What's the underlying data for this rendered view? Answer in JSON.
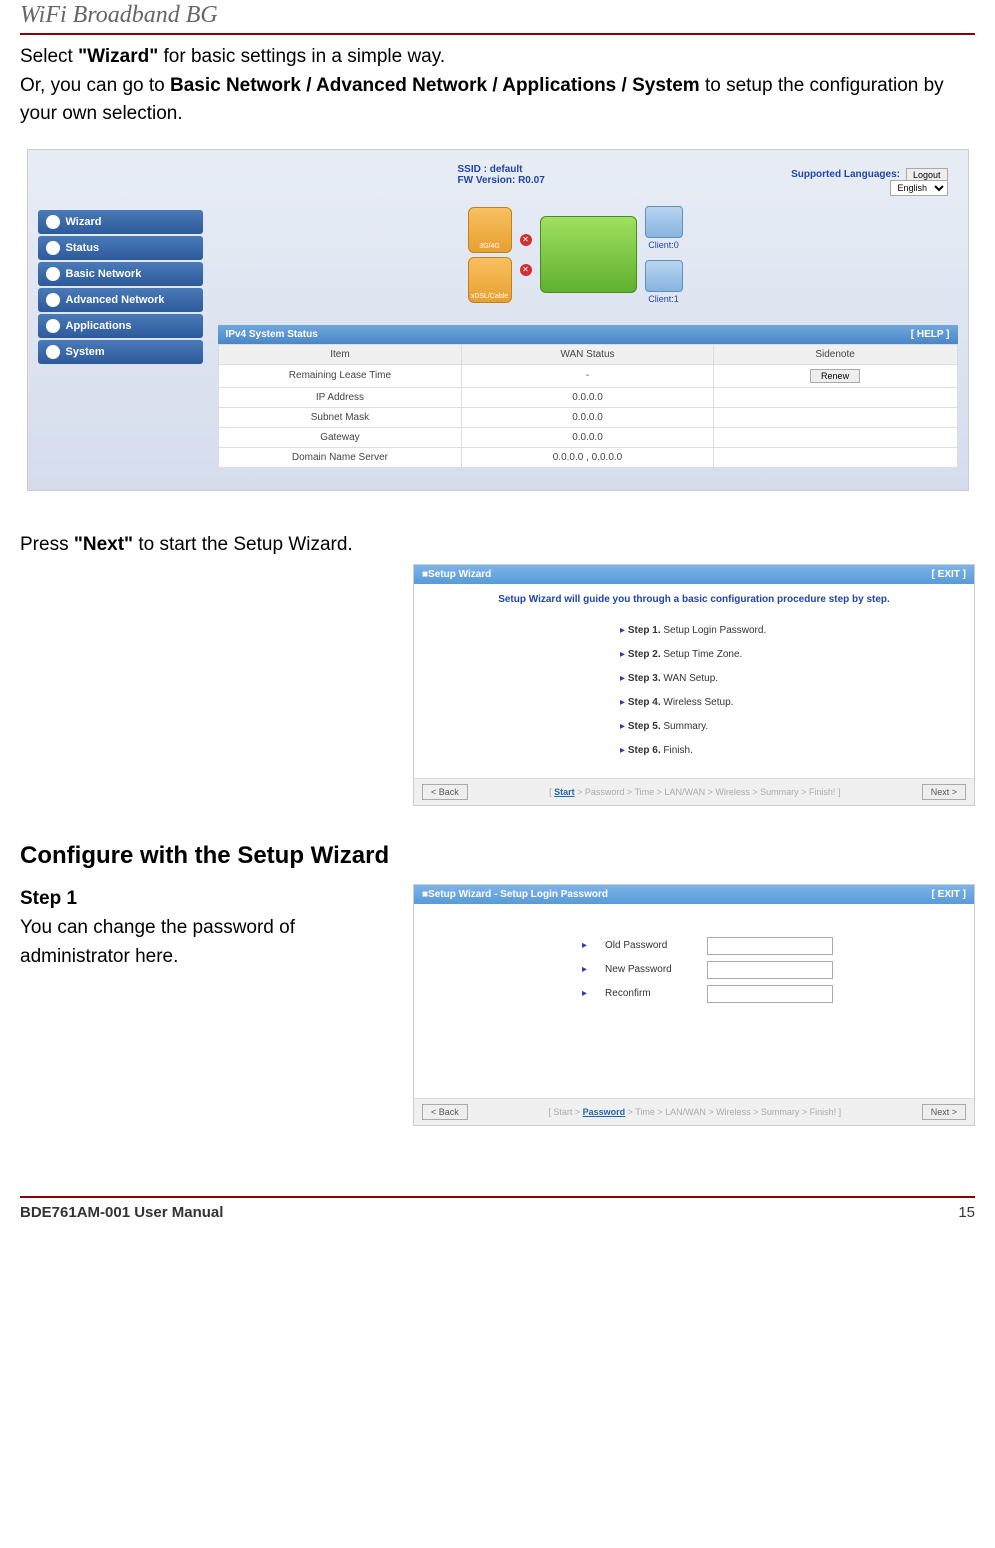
{
  "header": {
    "title": "WiFi Broadband BG"
  },
  "intro": {
    "p1_a": "Select ",
    "p1_b": "\"Wizard\"",
    "p1_c": " for basic settings in a simple way.",
    "p2_a": "Or, you can go to ",
    "p2_b": "Basic Network / Advanced Network / Applications / System",
    "p2_c": " to setup the configuration by your own selection."
  },
  "shot1": {
    "ssid_label": "SSID :",
    "ssid_value": "default",
    "fw_label": "FW Version:",
    "fw_value": "R0.07",
    "supported_langs": "Supported Languages:",
    "logout": "Logout",
    "lang": "English",
    "nav": [
      "Wizard",
      "Status",
      "Basic Network",
      "Advanced Network",
      "Applications",
      "System"
    ],
    "diag": {
      "box1": "3G/4G",
      "box2": "xDSL/Cable",
      "client0": "Client:0",
      "client1": "Client:1"
    },
    "panel_title": "IPv4 System Status",
    "panel_help": "[ HELP ]",
    "cols": [
      "Item",
      "WAN Status",
      "Sidenote"
    ],
    "rows": [
      {
        "item": "Remaining Lease Time",
        "wan": "-",
        "side": "Renew",
        "btn": true
      },
      {
        "item": "IP Address",
        "wan": "0.0.0.0",
        "side": ""
      },
      {
        "item": "Subnet Mask",
        "wan": "0.0.0.0",
        "side": ""
      },
      {
        "item": "Gateway",
        "wan": "0.0.0.0",
        "side": ""
      },
      {
        "item": "Domain Name Server",
        "wan": "0.0.0.0 , 0.0.0.0",
        "side": ""
      }
    ]
  },
  "mid": {
    "p1_a": "Press ",
    "p1_b": "\"Next\"",
    "p1_c": " to start the Setup Wizard."
  },
  "shot2": {
    "title": "Setup Wizard",
    "exit": "[ EXIT ]",
    "msg": "Setup Wizard will guide you through a basic configuration procedure step by step.",
    "steps": [
      {
        "b": "Step 1.",
        "t": " Setup Login Password."
      },
      {
        "b": "Step 2.",
        "t": " Setup Time Zone."
      },
      {
        "b": "Step 3.",
        "t": " WAN Setup."
      },
      {
        "b": "Step 4.",
        "t": " Wireless Setup."
      },
      {
        "b": "Step 5.",
        "t": " Summary."
      },
      {
        "b": "Step 6.",
        "t": " Finish."
      }
    ],
    "back": "< Back",
    "crumb_pre": "[ ",
    "crumb_active": "Start",
    "crumb_post": " > Password > Time > LAN/WAN > Wireless > Summary > Finish! ]",
    "next": "Next >"
  },
  "section": {
    "heading": "Configure with the Setup Wizard"
  },
  "step1": {
    "head": "Step 1",
    "text": "You can change the password of administrator here."
  },
  "shot3": {
    "title": "Setup Wizard - Setup Login Password",
    "exit": "[ EXIT ]",
    "fields": [
      "Old Password",
      "New Password",
      "Reconfirm"
    ],
    "back": "< Back",
    "crumb_pre": "[ Start > ",
    "crumb_active": "Password",
    "crumb_post": " > Time > LAN/WAN > Wireless > Summary > Finish! ]",
    "next": "Next >"
  },
  "footer": {
    "left": "BDE761AM-001    User Manual",
    "right": "15"
  }
}
